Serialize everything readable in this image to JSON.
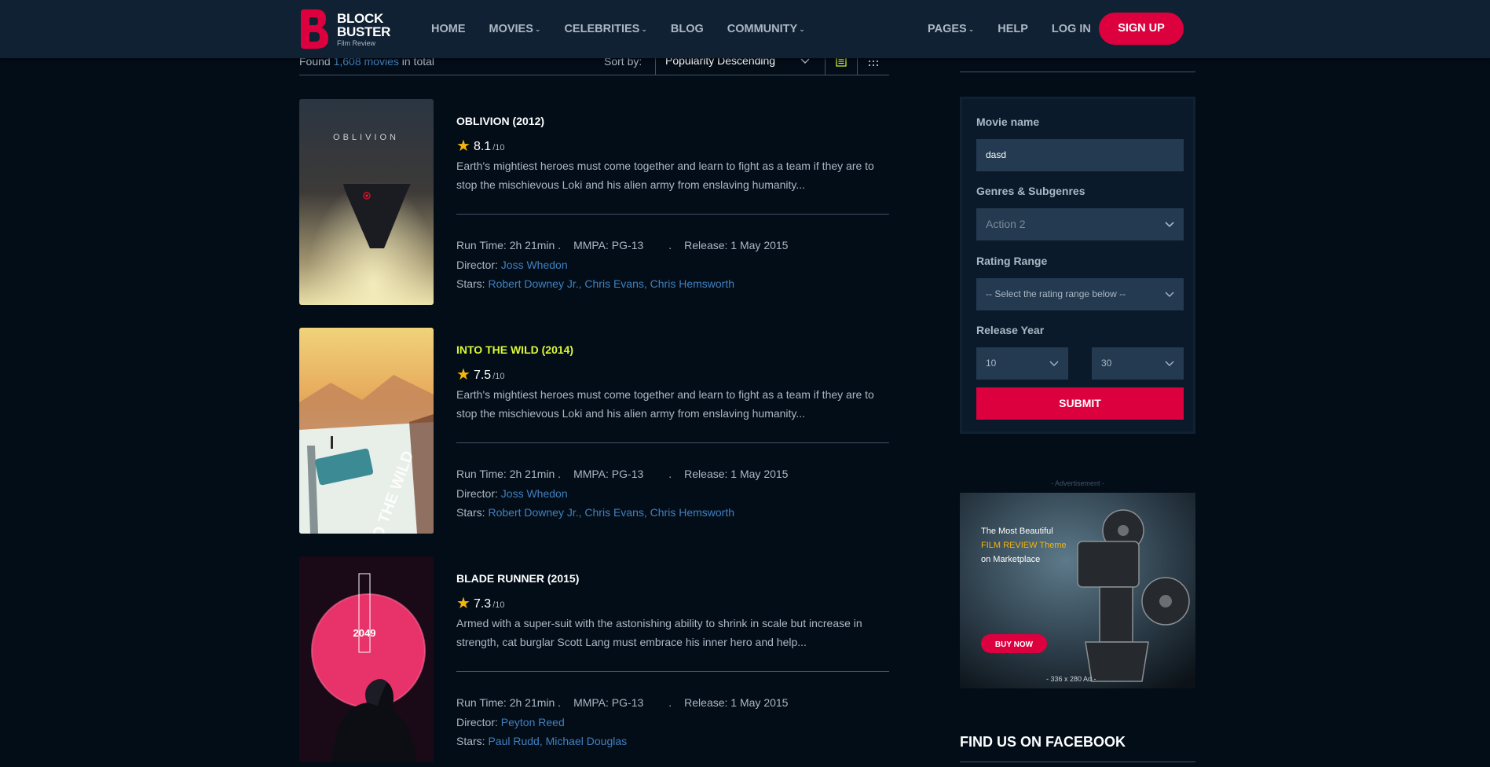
{
  "brand": {
    "line1": "BLOCK",
    "line2": "BUSTER",
    "line3": "Film Review",
    "accent": "#dd003f"
  },
  "nav": {
    "left": [
      {
        "label": "HOME"
      },
      {
        "label": "MOVIES"
      },
      {
        "label": "CELEBRITIES"
      },
      {
        "label": "BLOG"
      },
      {
        "label": "COMMUNITY"
      }
    ],
    "right": [
      {
        "label": "PAGES"
      },
      {
        "label": "HELP"
      },
      {
        "label": "LOG IN"
      }
    ],
    "signup": "SIGN UP"
  },
  "listing": {
    "found_prefix": "Found",
    "found_count": "1,608 movies",
    "found_suffix": "in total",
    "sort_label": "Sort by:",
    "sort_value": "Popularity Descending"
  },
  "movies": [
    {
      "title": "OBLIVION (2012)",
      "rating": "8.1",
      "rating_max": "/10",
      "description": "Earth's mightiest heroes must come together and learn to fight as a team if they are to stop the mischievous Loki and his alien army from enslaving humanity...",
      "runtime": "Run Time: 2h 21min .",
      "mmpa": "MMPA: PG-13",
      "dot": ".",
      "release": "Release: 1 May 2015",
      "director_label": "Director:",
      "director": "Joss Whedon",
      "stars_label": "Stars:",
      "stars": "Robert Downey Jr., Chris Evans, Chris Hemsworth",
      "poster_text": "OBLIVION"
    },
    {
      "title": "INTO THE WILD (2014)",
      "rating": "7.5",
      "rating_max": "/10",
      "description": "Earth's mightiest heroes must come together and learn to fight as a team if they are to stop the mischievous Loki and his alien army from enslaving humanity...",
      "runtime": "Run Time: 2h 21min .",
      "mmpa": "MMPA: PG-13",
      "dot": ".",
      "release": "Release: 1 May 2015",
      "director_label": "Director:",
      "director": "Joss Whedon",
      "stars_label": "Stars:",
      "stars": "Robert Downey Jr., Chris Evans, Chris Hemsworth",
      "poster_text": "INTO THE WILD"
    },
    {
      "title": "BLADE RUNNER (2015)",
      "rating": "7.3",
      "rating_max": "/10",
      "description": "Armed with a super-suit with the astonishing ability to shrink in scale but increase in strength, cat burglar Scott Lang must embrace his inner hero and help...",
      "runtime": "Run Time: 2h 21min .",
      "mmpa": "MMPA: PG-13",
      "dot": ".",
      "release": "Release: 1 May 2015",
      "director_label": "Director:",
      "director": "Peyton Reed",
      "stars_label": "Stars:",
      "stars": "Paul Rudd, Michael Douglas",
      "poster_text": "2049"
    }
  ],
  "search_form": {
    "movie_name_label": "Movie name",
    "movie_name_value": "dasd",
    "genres_label": "Genres & Subgenres",
    "genres_value": "Action 2",
    "rating_label": "Rating Range",
    "rating_value": "-- Select the rating range below --",
    "year_label": "Release Year",
    "year_from": "10",
    "year_to": "30",
    "submit": "SUBMIT"
  },
  "advertisement": {
    "label": "- Advertisement -",
    "line1": "The Most Beautiful",
    "line2": "FILM REVIEW Theme",
    "line3": "on Marketplace",
    "button": "BUY NOW",
    "size": "- 336 x 280 Ad -"
  },
  "facebook_heading": "FIND US ON FACEBOOK"
}
